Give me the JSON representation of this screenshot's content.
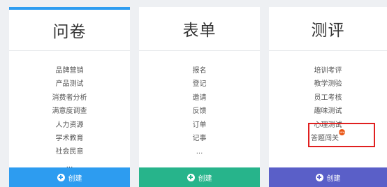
{
  "cards": [
    {
      "title": "问卷",
      "items": [
        "品牌营销",
        "产品测试",
        "消费者分析",
        "满意度调查",
        "人力资源",
        "学术教育",
        "社会民意",
        "..."
      ],
      "create_label": "创建",
      "accent": "#2d9cf0"
    },
    {
      "title": "表单",
      "items": [
        "报名",
        "登记",
        "邀请",
        "反馈",
        "订单",
        "记事",
        "..."
      ],
      "create_label": "创建",
      "accent": "#27b48b"
    },
    {
      "title": "测评",
      "items": [
        "培训考评",
        "教学测验",
        "员工考核",
        "趣味测试",
        "心理测试",
        "答题闯关"
      ],
      "new_badge": "new",
      "create_label": "创建",
      "accent": "#5a5fc8"
    }
  ],
  "highlight_color": "#e02020"
}
